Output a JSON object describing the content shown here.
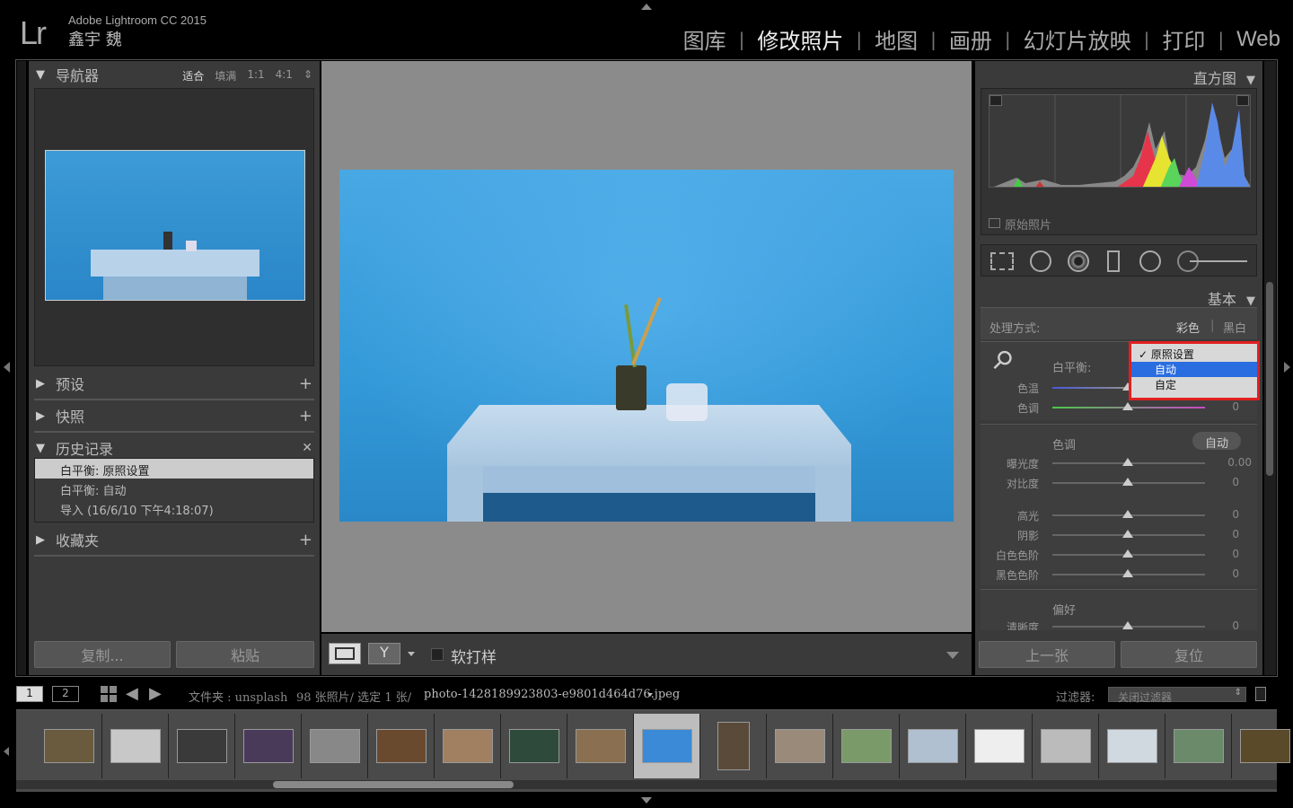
{
  "app": {
    "logo": "Lr",
    "name": "Adobe Lightroom CC 2015",
    "user": "鑫宇 魏"
  },
  "modules": [
    {
      "label": "图库",
      "active": false
    },
    {
      "label": "修改照片",
      "active": true
    },
    {
      "label": "地图",
      "active": false
    },
    {
      "label": "画册",
      "active": false
    },
    {
      "label": "幻灯片放映",
      "active": false
    },
    {
      "label": "打印",
      "active": false
    },
    {
      "label": "Web",
      "active": false
    }
  ],
  "left": {
    "navigator": {
      "title": "导航器",
      "zoom_options": [
        "适合",
        "填满",
        "1:1",
        "4:1"
      ]
    },
    "presets": "预设",
    "snapshots": "快照",
    "history": {
      "title": "历史记录",
      "items": [
        "白平衡: 原照设置",
        "白平衡: 自动",
        "导入 (16/6/10 下午4:18:07)"
      ]
    },
    "collections": "收藏夹",
    "copy_btn": "复制...",
    "paste_btn": "粘贴"
  },
  "toolbar": {
    "soft_proof": "软打样"
  },
  "right": {
    "histogram": {
      "title": "直方图",
      "original": "原始照片"
    },
    "basic": {
      "title": "基本",
      "treatment_label": "处理方式:",
      "color": "彩色",
      "bw": "黑白",
      "wb_label": "白平衡:",
      "wb_options": [
        "原照设置",
        "自动",
        "自定"
      ],
      "wb_selected": "原照设置",
      "wb_highlighted": "自动",
      "temp": {
        "label": "色温",
        "value": ""
      },
      "tint": {
        "label": "色调",
        "value": "0"
      },
      "tone_label": "色调",
      "auto": "自动",
      "exposure": {
        "label": "曝光度",
        "value": "0.00"
      },
      "contrast": {
        "label": "对比度",
        "value": "0"
      },
      "highlights": {
        "label": "高光",
        "value": "0"
      },
      "shadows": {
        "label": "阴影",
        "value": "0"
      },
      "whites": {
        "label": "白色色阶",
        "value": "0"
      },
      "blacks": {
        "label": "黑色色阶",
        "value": "0"
      },
      "presence_label": "偏好",
      "clarity": {
        "label": "清晰度",
        "value": "0"
      }
    },
    "prev_btn": "上一张",
    "reset_btn": "复位"
  },
  "filmbar": {
    "screen1": "1",
    "screen2": "2",
    "source": "文件夹 : unsplash",
    "count": "98 张照片/ 选定 1 张/",
    "filename": "photo-1428189923803-e9801d464d76.jpeg",
    "filter_label": "过滤器:",
    "filter_value": "关闭过滤器"
  },
  "filmstrip_colors": [
    "#6a5a3e",
    "#c8c8c8",
    "#3a3a3a",
    "#4a3a5a",
    "#888",
    "#6a4a2e",
    "#a08060",
    "#2e4a3a",
    "#8a7050",
    "#3a8ad8",
    "#5a4a3a",
    "#9a8a7a",
    "#7a9a6a",
    "#b0c0d0",
    "#eeeeee",
    "#bbbbbb",
    "#d0d8e0",
    "#6a8a6a",
    "#5a4a2a"
  ]
}
